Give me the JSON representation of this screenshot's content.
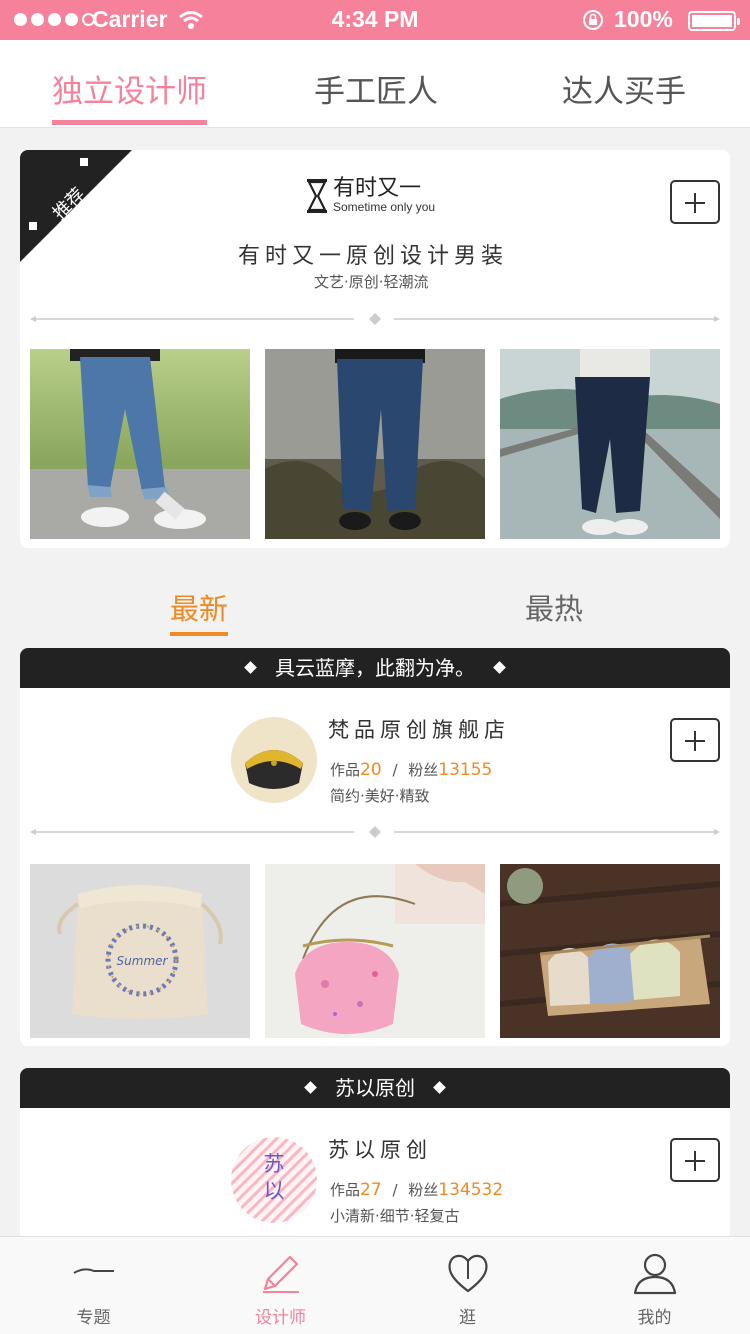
{
  "status_bar": {
    "carrier": "Carrier",
    "time": "4:34 PM",
    "battery": "100%"
  },
  "top_tabs": [
    {
      "label": "独立设计师",
      "active": true
    },
    {
      "label": "手工匠人",
      "active": false
    },
    {
      "label": "达人买手",
      "active": false
    }
  ],
  "featured": {
    "badge": "推荐",
    "brand_name": "有时又一",
    "brand_sub": "Sometime only you",
    "title": "有时又一原创设计男装",
    "tags": "文艺·原创·轻潮流"
  },
  "section_tabs": [
    {
      "label": "最新",
      "active": true
    },
    {
      "label": "最热",
      "active": false
    }
  ],
  "stores": [
    {
      "header": "具云蓝摩，此翻为净。",
      "name": "梵品原创旗舰店",
      "works_label": "作品",
      "works": "20",
      "separator": "/",
      "fans_label": "粉丝",
      "fans": "13155",
      "tags": "简约·美好·精致"
    },
    {
      "header": "苏以原创",
      "name": "苏以原创",
      "avatar_text": "苏以",
      "works_label": "作品",
      "works": "27",
      "separator": "/",
      "fans_label": "粉丝",
      "fans": "134532",
      "tags": "小清新·细节·轻复古"
    }
  ],
  "bottom_nav": [
    {
      "label": "专题",
      "icon": "topic-line-icon",
      "active": false
    },
    {
      "label": "设计师",
      "icon": "pencil-icon",
      "active": true
    },
    {
      "label": "逛",
      "icon": "heart-icon",
      "active": false
    },
    {
      "label": "我的",
      "icon": "user-icon",
      "active": false
    }
  ],
  "colors": {
    "accent_pink": "#f6819a",
    "accent_orange": "#f08a22",
    "dark": "#222222"
  }
}
